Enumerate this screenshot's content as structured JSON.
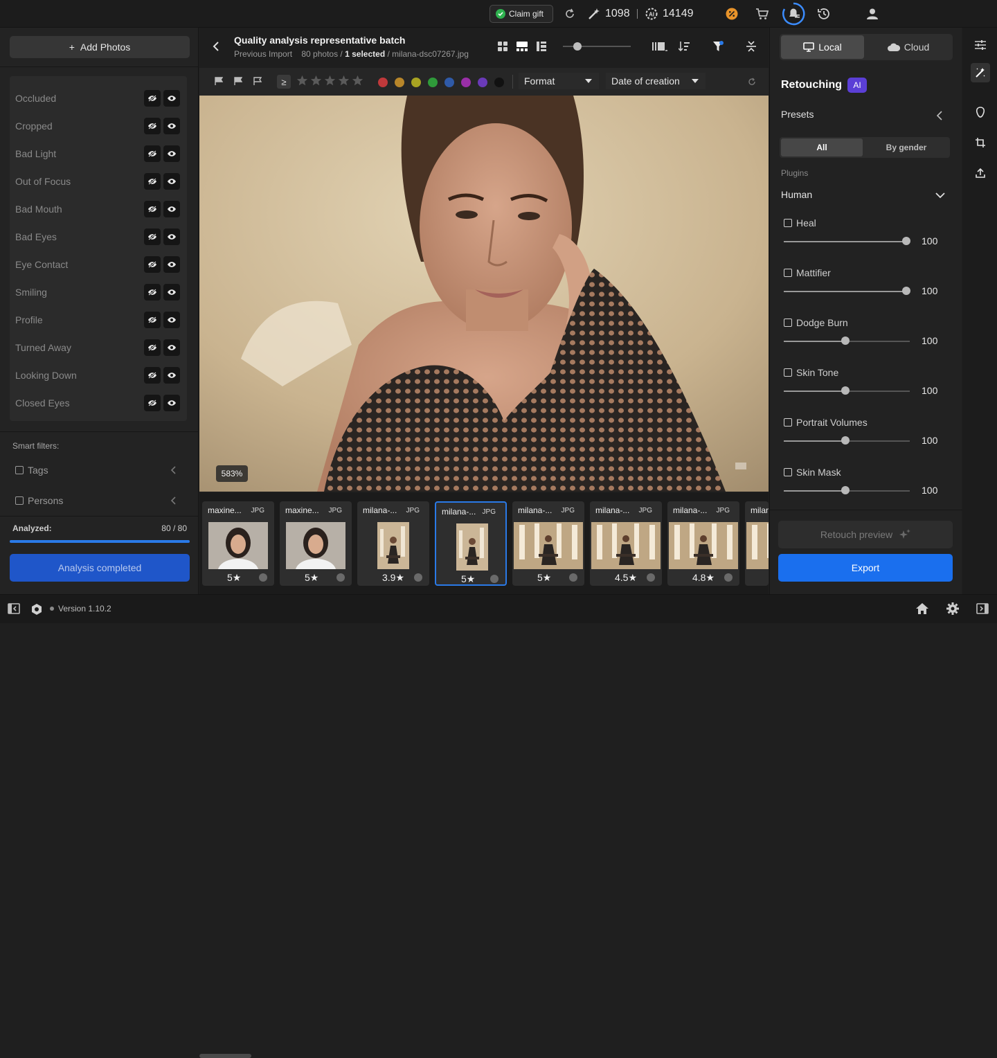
{
  "topbar": {
    "claim_gift": "Claim gift",
    "credits": "1098",
    "ai_credits": "14149"
  },
  "left": {
    "add_photos": "Add Photos",
    "filters": [
      {
        "label": "Occluded"
      },
      {
        "label": "Cropped"
      },
      {
        "label": "Bad Light"
      },
      {
        "label": "Out of Focus"
      },
      {
        "label": "Bad Mouth"
      },
      {
        "label": "Bad Eyes"
      },
      {
        "label": "Eye Contact"
      },
      {
        "label": "Smiling"
      },
      {
        "label": "Profile"
      },
      {
        "label": "Turned Away"
      },
      {
        "label": "Looking Down"
      },
      {
        "label": "Closed Eyes"
      }
    ],
    "smart_filters": "Smart filters:",
    "tags": "Tags",
    "persons": "Persons",
    "analyzed_label": "Analyzed:",
    "analyzed_value": "80 / 80",
    "analyzed_progress": 1.0,
    "analysis_completed": "Analysis completed"
  },
  "header": {
    "title": "Quality analysis representative batch",
    "previous_import": "Previous Import",
    "photos": "80 photos /",
    "selected": "1 selected",
    "filename": "/ milana-dsc07267.jpg"
  },
  "filterbar": {
    "gte": "≥",
    "format": "Format",
    "date": "Date of creation",
    "color_labels": [
      "#c0393b",
      "#b8862a",
      "#a8a322",
      "#2f9a3a",
      "#2f5aa8",
      "#9a2fa8",
      "#6a3ab8",
      "#111111"
    ]
  },
  "viewer": {
    "zoom": "583%"
  },
  "thumbnails": [
    {
      "name": "maxine...",
      "format": "JPG",
      "rating": "5★",
      "selected": false
    },
    {
      "name": "maxine...",
      "format": "JPG",
      "rating": "5★",
      "selected": false
    },
    {
      "name": "milana-...",
      "format": "JPG",
      "rating": "3.9★",
      "selected": false
    },
    {
      "name": "milana-...",
      "format": "JPG",
      "rating": "5★",
      "selected": true
    },
    {
      "name": "milana-...",
      "format": "JPG",
      "rating": "5★",
      "selected": false
    },
    {
      "name": "milana-...",
      "format": "JPG",
      "rating": "4.5★",
      "selected": false
    },
    {
      "name": "milana-...",
      "format": "JPG",
      "rating": "4.8★",
      "selected": false
    },
    {
      "name": "milan",
      "format": "",
      "rating": "",
      "selected": false
    }
  ],
  "right": {
    "local": "Local",
    "cloud": "Cloud",
    "retouching": "Retouching",
    "ai_badge": "AI",
    "presets": "Presets",
    "all": "All",
    "by_gender": "By gender",
    "plugins": "Plugins",
    "human": "Human",
    "plugin_items": [
      {
        "name": "Heal",
        "value": "100",
        "level": 1.0
      },
      {
        "name": "Mattifier",
        "value": "100",
        "level": 1.0
      },
      {
        "name": "Dodge Burn",
        "value": "100",
        "level": 0.5
      },
      {
        "name": "Skin Tone",
        "value": "100",
        "level": 0.5
      },
      {
        "name": "Portrait Volumes",
        "value": "100",
        "level": 0.5
      },
      {
        "name": "Skin Mask",
        "value": "100",
        "level": 0.5
      }
    ],
    "retouch_preview": "Retouch preview",
    "export": "Export"
  },
  "footer": {
    "version": "Version 1.10.2"
  }
}
